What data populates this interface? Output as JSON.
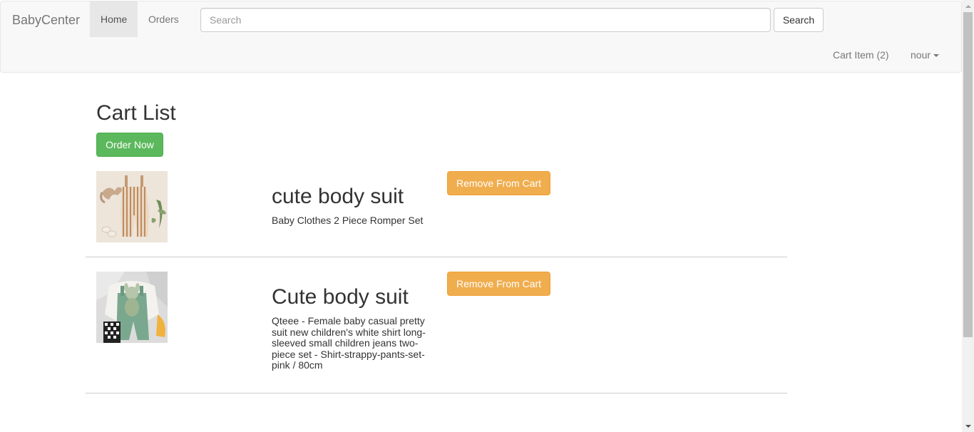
{
  "navbar": {
    "brand": "BabyCenter",
    "links": [
      {
        "label": "Home",
        "active": true
      },
      {
        "label": "Orders",
        "active": false
      }
    ],
    "search": {
      "placeholder": "Search",
      "value": "",
      "button_label": "Search"
    },
    "cart_label": "Cart Item (2)",
    "user_label": "nour"
  },
  "main": {
    "title": "Cart List",
    "order_button": "Order Now",
    "items": [
      {
        "name": "cute body suit",
        "description": "Baby Clothes 2 Piece Romper Set",
        "remove_label": "Remove From Cart",
        "image_icon": "romper-photo"
      },
      {
        "name": "Cute body suit",
        "description": "Qteee - Female baby casual pretty suit new children's white shirt long-sleeved small children jeans two-piece set - Shirt-strappy-pants-set-pink / 80cm",
        "remove_label": "Remove From Cart",
        "image_icon": "overalls-photo"
      }
    ]
  },
  "colors": {
    "success": "#5cb85c",
    "warning": "#f0ad4e",
    "navbar_bg": "#f8f8f8"
  }
}
